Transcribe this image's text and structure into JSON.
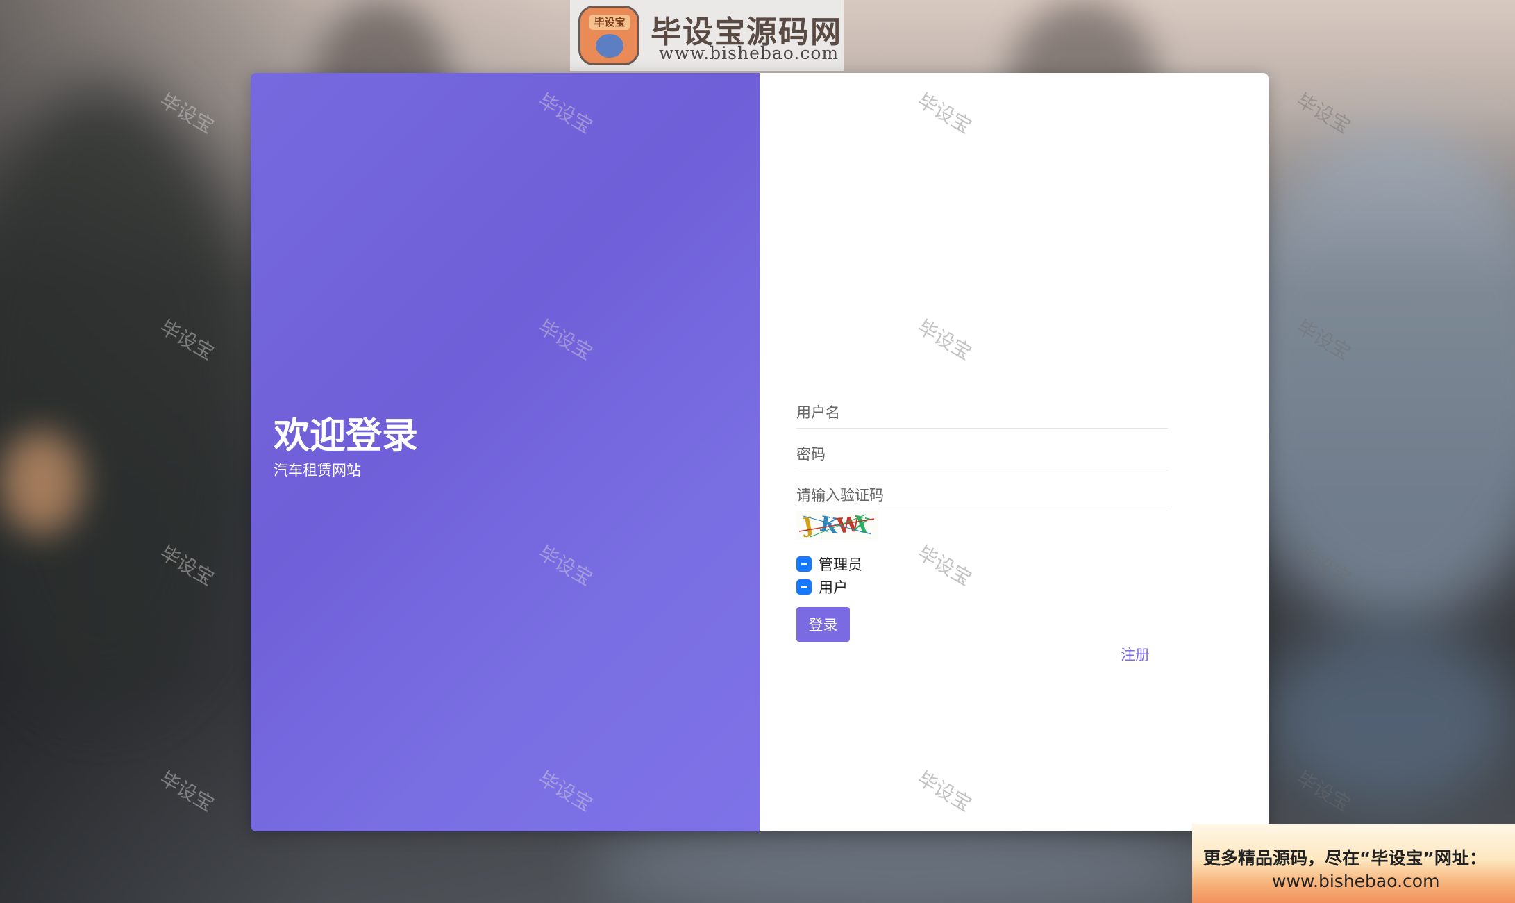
{
  "logo": {
    "badge": "毕设宝",
    "name": "毕设宝源码网",
    "url": "www.bishebao.com"
  },
  "welcome": {
    "title": "欢迎登录",
    "subtitle": "汽车租赁网站"
  },
  "form": {
    "username_placeholder": "用户名",
    "password_placeholder": "密码",
    "captcha_placeholder": "请输入验证码",
    "captcha_code": "JKWX",
    "roles": [
      "管理员",
      "用户"
    ],
    "login_label": "登录",
    "register_label": "注册"
  },
  "watermark": "毕设宝",
  "promo": {
    "line1": "更多精品源码，尽在“毕设宝”网址：",
    "line2": "www.bishebao.com"
  },
  "colors": {
    "accent": "#7b6be3",
    "checkbox": "#1677ff"
  }
}
